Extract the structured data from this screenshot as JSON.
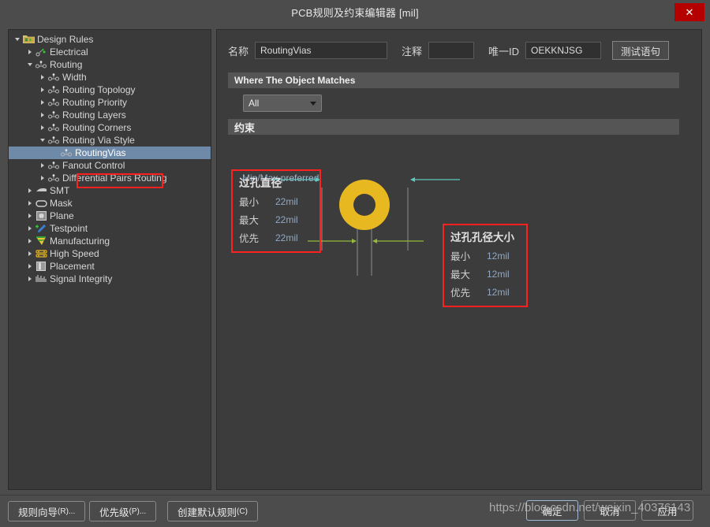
{
  "window": {
    "title": "PCB规则及约束编辑器 [mil]",
    "close_label": "✕"
  },
  "sidebar": {
    "items": [
      {
        "label": "Design Rules",
        "icon": "folder-rules-icon",
        "depth": 0,
        "state": "expanded",
        "selected": false
      },
      {
        "label": "Electrical",
        "icon": "electrical-icon",
        "depth": 1,
        "state": "collapsed",
        "selected": false
      },
      {
        "label": "Routing",
        "icon": "routing-icon",
        "depth": 1,
        "state": "expanded",
        "selected": false
      },
      {
        "label": "Width",
        "icon": "routing-icon",
        "depth": 2,
        "state": "collapsed",
        "selected": false
      },
      {
        "label": "Routing Topology",
        "icon": "routing-icon",
        "depth": 2,
        "state": "collapsed",
        "selected": false
      },
      {
        "label": "Routing Priority",
        "icon": "routing-icon",
        "depth": 2,
        "state": "collapsed",
        "selected": false
      },
      {
        "label": "Routing Layers",
        "icon": "routing-icon",
        "depth": 2,
        "state": "collapsed",
        "selected": false
      },
      {
        "label": "Routing Corners",
        "icon": "routing-icon",
        "depth": 2,
        "state": "collapsed",
        "selected": false
      },
      {
        "label": "Routing Via Style",
        "icon": "routing-icon",
        "depth": 2,
        "state": "expanded",
        "selected": false
      },
      {
        "label": "RoutingVias",
        "icon": "routing-icon",
        "depth": 3,
        "state": "leaf",
        "selected": true
      },
      {
        "label": "Fanout Control",
        "icon": "routing-icon",
        "depth": 2,
        "state": "collapsed",
        "selected": false
      },
      {
        "label": "Differential Pairs Routing",
        "icon": "routing-icon",
        "depth": 2,
        "state": "collapsed",
        "selected": false
      },
      {
        "label": "SMT",
        "icon": "smt-icon",
        "depth": 1,
        "state": "collapsed",
        "selected": false
      },
      {
        "label": "Mask",
        "icon": "mask-icon",
        "depth": 1,
        "state": "collapsed",
        "selected": false
      },
      {
        "label": "Plane",
        "icon": "plane-icon",
        "depth": 1,
        "state": "collapsed",
        "selected": false
      },
      {
        "label": "Testpoint",
        "icon": "testpoint-icon",
        "depth": 1,
        "state": "collapsed",
        "selected": false
      },
      {
        "label": "Manufacturing",
        "icon": "manufacturing-icon",
        "depth": 1,
        "state": "collapsed",
        "selected": false
      },
      {
        "label": "High Speed",
        "icon": "highspeed-icon",
        "depth": 1,
        "state": "collapsed",
        "selected": false
      },
      {
        "label": "Placement",
        "icon": "placement-icon",
        "depth": 1,
        "state": "collapsed",
        "selected": false
      },
      {
        "label": "Signal Integrity",
        "icon": "signalintegrity-icon",
        "depth": 1,
        "state": "collapsed",
        "selected": false
      }
    ]
  },
  "form": {
    "name_label": "名称",
    "name_value": "RoutingVias",
    "comment_label": "注释",
    "comment_value": "",
    "uid_label": "唯一ID",
    "uid_value": "OEKKNJSG",
    "test_button": "测试语句"
  },
  "sections": {
    "where_header": "Where The Object Matches",
    "scope_value": "All",
    "constraint_header": "约束",
    "minmax_label": "Min/Max preferred"
  },
  "constraints": {
    "via_diameter": {
      "title": "过孔直径",
      "rows": [
        {
          "key": "最小",
          "value": "22mil"
        },
        {
          "key": "最大",
          "value": "22mil"
        },
        {
          "key": "优先",
          "value": "22mil"
        }
      ]
    },
    "via_hole_size": {
      "title": "过孔孔径大小",
      "rows": [
        {
          "key": "最小",
          "value": "12mil"
        },
        {
          "key": "最大",
          "value": "12mil"
        },
        {
          "key": "优先",
          "value": "12mil"
        }
      ]
    }
  },
  "footer": {
    "wizard_label": "规则向导",
    "wizard_accel": "(R)...",
    "priority_label": "优先级",
    "priority_accel": "(P)...",
    "default_label": "创建默认规则",
    "default_accel": "(C)",
    "ok_label": "确定",
    "cancel_label": "取消",
    "apply_label": "应用"
  },
  "watermark": {
    "text": "https://blog.csdn.net/weixin_40376143"
  },
  "colors": {
    "via_copper": "#e8b820",
    "highlight_red": "#ff2020",
    "dimension_cyan": "#5ec8c0",
    "dimension_green": "#93b83c",
    "selection_blue": "#6f8aa8",
    "close_red": "#b50000"
  }
}
